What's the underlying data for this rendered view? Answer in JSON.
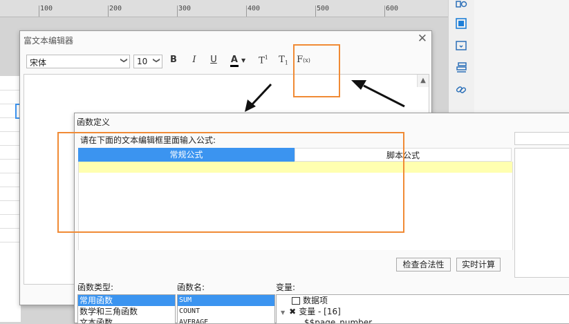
{
  "ruler": {
    "ticks": [
      "100",
      "200",
      "300",
      "400",
      "500",
      "600"
    ]
  },
  "side_toolbar": {
    "icons": [
      "info-icon",
      "frame-icon",
      "tray-icon",
      "layers-icon",
      "link-icon"
    ]
  },
  "rich_text_editor": {
    "title": "富文本编辑器",
    "close": "✕",
    "font_family": "宋体",
    "font_size": "10",
    "bold": "B",
    "italic": "I",
    "underline": "U",
    "font_color": "A",
    "superscript": "T",
    "superscript_mark": "1",
    "subscript": "T",
    "subscript_mark": "1",
    "formula": "F",
    "formula_mark": "(x)",
    "chevron": "❯"
  },
  "function_dialog": {
    "title": "函数定义",
    "prompt": "请在下面的文本编辑框里面输入公式:",
    "tabs": {
      "normal": "常规公式",
      "script": "脚本公式"
    },
    "buttons": {
      "check": "检查合法性",
      "compute": "实时计算"
    },
    "category_label": "函数类型:",
    "categories": [
      "常用函数",
      "数学和三角函数",
      "文本函数"
    ],
    "name_label": "函数名:",
    "function_names": [
      "SUM",
      "COUNT",
      "AVERAGE"
    ],
    "variable_label": "变量:",
    "variables": {
      "data_item": "数据项",
      "var_group": "变量 - [16]",
      "page_number": "$$page_number"
    }
  },
  "colors": {
    "accent": "#3b94f0",
    "annotation": "#f08a34",
    "formula_line": "#ffffb0"
  }
}
